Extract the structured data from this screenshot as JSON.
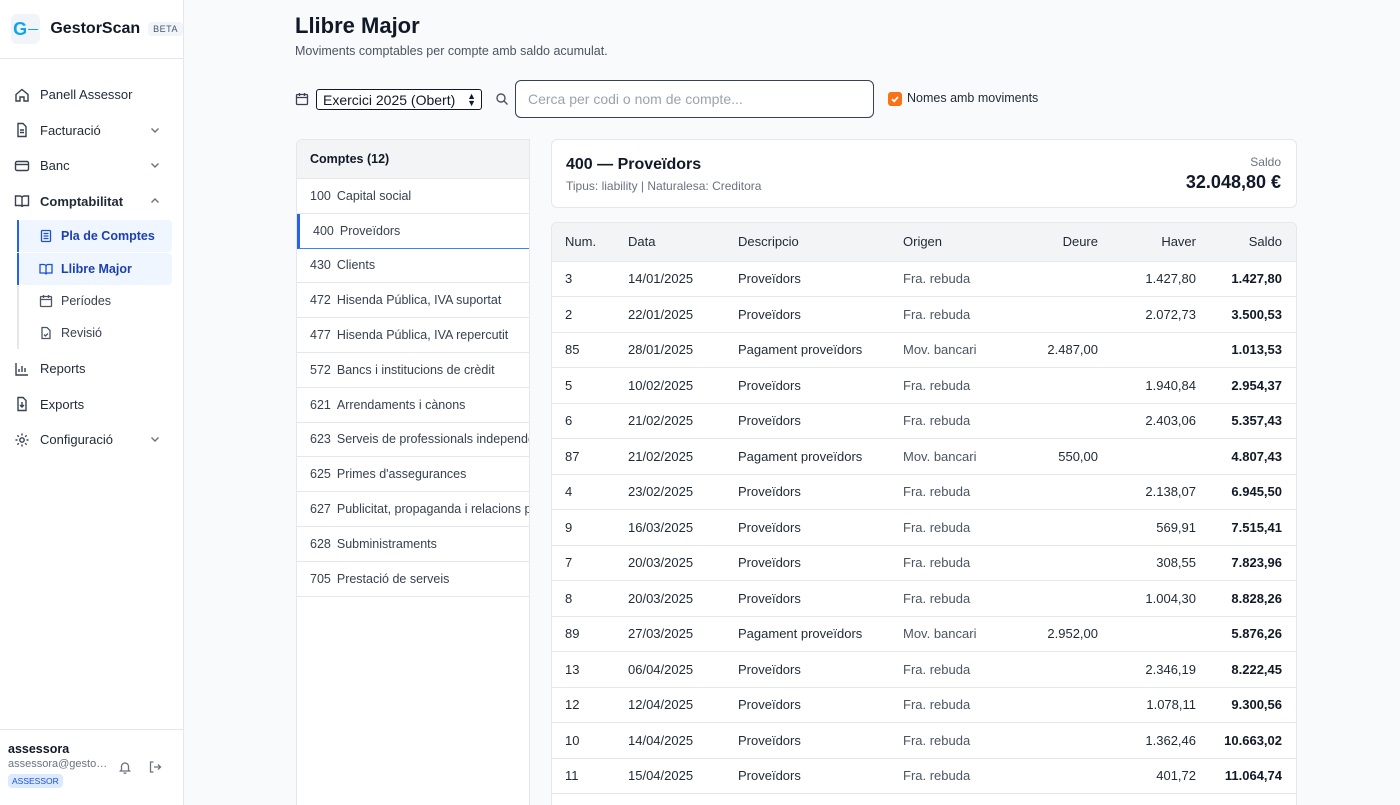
{
  "app": {
    "name": "GestorScan",
    "badge": "BETA",
    "logo_text": "G"
  },
  "sidebar": {
    "items": [
      {
        "label": "Panell Assessor",
        "icon": "home-icon"
      },
      {
        "label": "Facturació",
        "icon": "file-icon"
      },
      {
        "label": "Banc",
        "icon": "card-icon"
      },
      {
        "label": "Comptabilitat",
        "icon": "book-icon"
      }
    ],
    "sub_items": [
      {
        "label": "Pla de Comptes",
        "icon": "list-icon",
        "active": true
      },
      {
        "label": "Llibre Major",
        "icon": "book-open-icon",
        "active": true
      },
      {
        "label": "Períodes",
        "icon": "calendar-icon",
        "active": false
      },
      {
        "label": "Revisió",
        "icon": "doc-check-icon",
        "active": false
      }
    ],
    "bottom_items": [
      {
        "label": "Reports",
        "icon": "chart-icon"
      },
      {
        "label": "Exports",
        "icon": "export-icon"
      },
      {
        "label": "Configuració",
        "icon": "gear-icon"
      }
    ]
  },
  "user": {
    "name": "assessora",
    "email": "assessora@gestorscan",
    "role": "ASSESSOR"
  },
  "page": {
    "title": "Llibre Major",
    "subtitle": "Moviments comptables per compte amb saldo acumulat."
  },
  "filters": {
    "exercise": "Exercici 2025 (Obert)",
    "search_placeholder": "Cerca per codi o nom de compte...",
    "only_movements_label": "Nomes amb moviments",
    "only_movements_checked": true
  },
  "accounts": {
    "header": "Comptes (12)",
    "items": [
      {
        "code": "100",
        "name": "Capital social"
      },
      {
        "code": "400",
        "name": "Proveïdors"
      },
      {
        "code": "430",
        "name": "Clients"
      },
      {
        "code": "472",
        "name": "Hisenda Pública, IVA suportat"
      },
      {
        "code": "477",
        "name": "Hisenda Pública, IVA repercutit"
      },
      {
        "code": "572",
        "name": "Bancs i institucions de crèdit"
      },
      {
        "code": "621",
        "name": "Arrendaments i cànons"
      },
      {
        "code": "623",
        "name": "Serveis de professionals independents"
      },
      {
        "code": "625",
        "name": "Primes d'assegurances"
      },
      {
        "code": "627",
        "name": "Publicitat, propaganda i relacions públiques"
      },
      {
        "code": "628",
        "name": "Subministraments"
      },
      {
        "code": "705",
        "name": "Prestació de serveis"
      }
    ],
    "active_index": 1
  },
  "ledger": {
    "title": "400 — Proveïdors",
    "meta": "Tipus: liability | Naturalesa: Creditora",
    "saldo_label": "Saldo",
    "saldo_value": "32.048,80 €",
    "columns": [
      "Num.",
      "Data",
      "Descripcio",
      "Origen",
      "Deure",
      "Haver",
      "Saldo"
    ],
    "rows": [
      [
        "3",
        "14/01/2025",
        "Proveïdors",
        "Fra. rebuda",
        "",
        "1.427,80",
        "1.427,80"
      ],
      [
        "2",
        "22/01/2025",
        "Proveïdors",
        "Fra. rebuda",
        "",
        "2.072,73",
        "3.500,53"
      ],
      [
        "85",
        "28/01/2025",
        "Pagament proveïdors",
        "Mov. bancari",
        "2.487,00",
        "",
        "1.013,53"
      ],
      [
        "5",
        "10/02/2025",
        "Proveïdors",
        "Fra. rebuda",
        "",
        "1.940,84",
        "2.954,37"
      ],
      [
        "6",
        "21/02/2025",
        "Proveïdors",
        "Fra. rebuda",
        "",
        "2.403,06",
        "5.357,43"
      ],
      [
        "87",
        "21/02/2025",
        "Pagament proveïdors",
        "Mov. bancari",
        "550,00",
        "",
        "4.807,43"
      ],
      [
        "4",
        "23/02/2025",
        "Proveïdors",
        "Fra. rebuda",
        "",
        "2.138,07",
        "6.945,50"
      ],
      [
        "9",
        "16/03/2025",
        "Proveïdors",
        "Fra. rebuda",
        "",
        "569,91",
        "7.515,41"
      ],
      [
        "7",
        "20/03/2025",
        "Proveïdors",
        "Fra. rebuda",
        "",
        "308,55",
        "7.823,96"
      ],
      [
        "8",
        "20/03/2025",
        "Proveïdors",
        "Fra. rebuda",
        "",
        "1.004,30",
        "8.828,26"
      ],
      [
        "89",
        "27/03/2025",
        "Pagament proveïdors",
        "Mov. bancari",
        "2.952,00",
        "",
        "5.876,26"
      ],
      [
        "13",
        "06/04/2025",
        "Proveïdors",
        "Fra. rebuda",
        "",
        "2.346,19",
        "8.222,45"
      ],
      [
        "12",
        "12/04/2025",
        "Proveïdors",
        "Fra. rebuda",
        "",
        "1.078,11",
        "9.300,56"
      ],
      [
        "10",
        "14/04/2025",
        "Proveïdors",
        "Fra. rebuda",
        "",
        "1.362,46",
        "10.663,02"
      ],
      [
        "11",
        "15/04/2025",
        "Proveïdors",
        "Fra. rebuda",
        "",
        "401,72",
        "11.064,74"
      ],
      [
        "",
        "",
        "",
        "",
        "",
        "",
        ""
      ]
    ]
  },
  "colors": {
    "accent": "#2563eb",
    "checkbox": "#f97316",
    "active_bg": "#eff6ff"
  }
}
